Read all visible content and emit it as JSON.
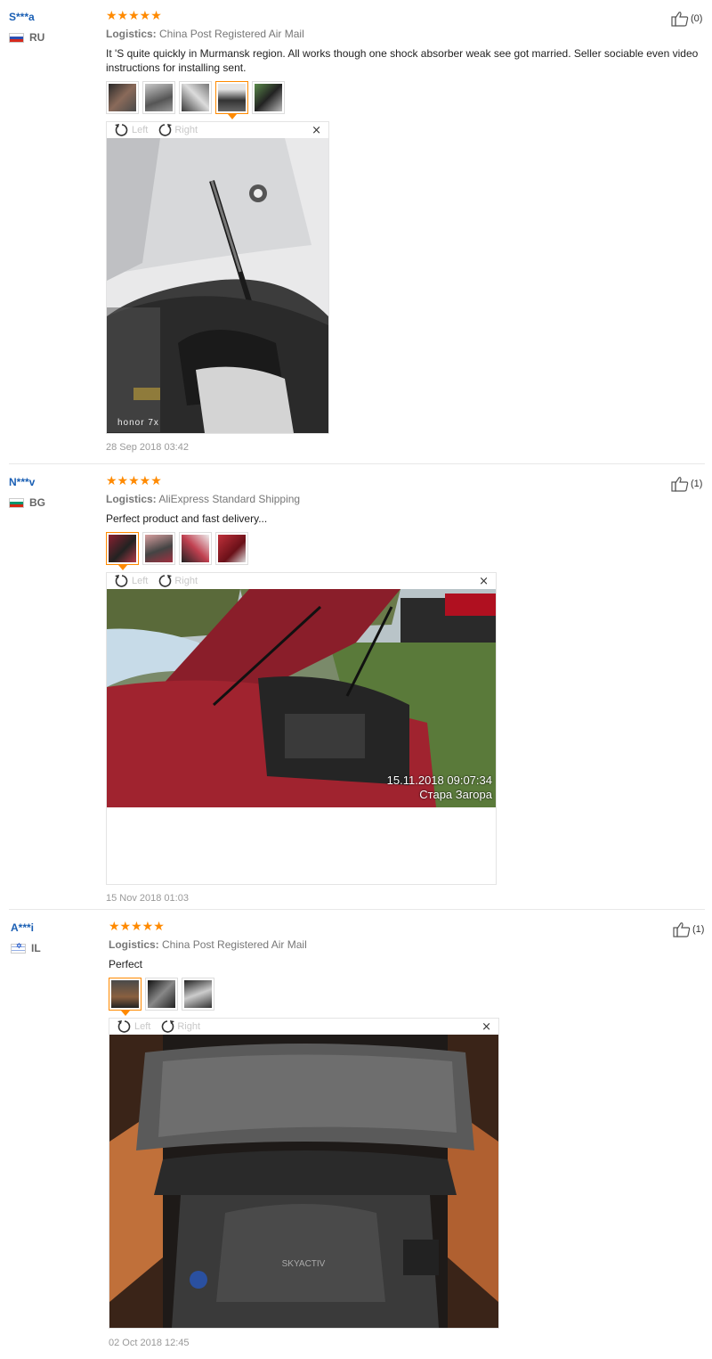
{
  "reviews": [
    {
      "user": "S***a",
      "country": "RU",
      "stars": "★★★★★",
      "logistics_label": "Logistics:",
      "logistics": "China Post Registered Air Mail",
      "feedback": "It 'S quite quickly in Murmansk region. All works though one shock absorber weak see got married. Seller sociable even video instructions for installing sent.",
      "likes": "(0)",
      "date": "28 Sep 2018 03:42",
      "photo_watermark": "honor 7x"
    },
    {
      "user": "N***v",
      "country": "BG",
      "stars": "★★★★★",
      "logistics_label": "Logistics:",
      "logistics": "AliExpress Standard Shipping",
      "feedback": "Perfect product and fast delivery...",
      "likes": "(1)",
      "date": "15 Nov 2018 01:03",
      "photo_stamp_line1": "15.11.2018 09:07:34",
      "photo_stamp_line2": "Стара Загора"
    },
    {
      "user": "A***i",
      "country": "IL",
      "stars": "★★★★★",
      "logistics_label": "Logistics:",
      "logistics": "China Post Registered Air Mail",
      "feedback": "Perfect",
      "likes": "(1)",
      "date": "02 Oct 2018 12:45"
    }
  ],
  "viewer": {
    "rotate_left": "Left",
    "rotate_right": "Right",
    "close": "×"
  },
  "icons": {
    "like": "thumbs-up-icon",
    "rotate_left": "rotate-left-icon",
    "rotate_right": "rotate-right-icon",
    "close": "close-icon"
  },
  "colors": {
    "star": "#ff8a00",
    "username": "#1a5fb4",
    "active_thumb": "#ff8a00"
  }
}
